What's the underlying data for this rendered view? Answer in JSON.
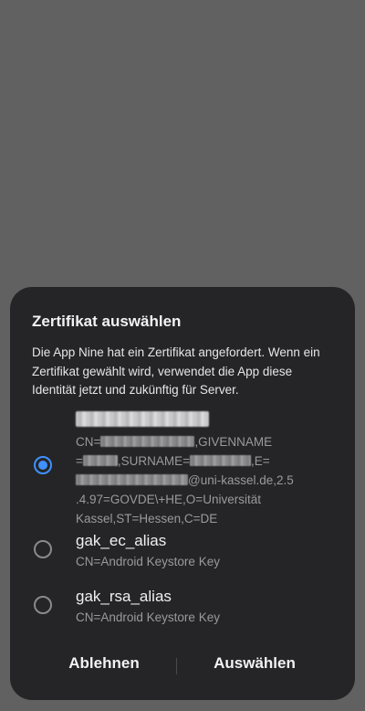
{
  "dialog": {
    "title": "Zertifikat auswählen",
    "message": "Die App Nine hat ein Zertifikat angefordert. Wenn ein Zertifikat gewählt wird, verwendet die App diese Identität jetzt und zukünftig für Server."
  },
  "options": [
    {
      "selected": true,
      "name_redacted": true,
      "sub_parts": {
        "p1": "CN=",
        "p2": ",GIVENNAME",
        "p3": "=",
        "p4": ",SURNAME=",
        "p5": ",E=",
        "p6": "@uni-kassel.de,2.5",
        "p7": ".4.97=GOVDE\\+HE,O=Universität",
        "p8": "Kassel,ST=Hessen,C=DE"
      }
    },
    {
      "selected": false,
      "name": "gak_ec_alias",
      "sub": "CN=Android Keystore Key"
    },
    {
      "selected": false,
      "name": "gak_rsa_alias",
      "sub": "CN=Android Keystore Key"
    }
  ],
  "buttons": {
    "decline": "Ablehnen",
    "select": "Auswählen"
  },
  "colors": {
    "scrim": "#616161",
    "dialog_bg": "#252527",
    "accent": "#3e91ff"
  }
}
